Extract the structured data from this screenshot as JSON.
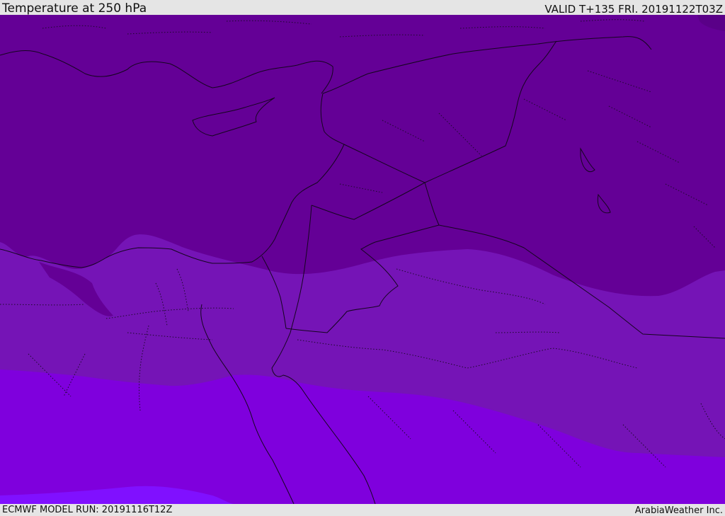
{
  "header": {
    "title": "Temperature at 250 hPa",
    "valid_time": "VALID T+135 FRI. 20191122T03Z"
  },
  "footer": {
    "model_run": "ECMWF MODEL RUN: 20191116T12Z",
    "credit": "ArabiaWeather Inc."
  },
  "map": {
    "field": "temperature",
    "level": "250 hPa",
    "band_colors": [
      "#640096",
      "#7514b6",
      "#7f00dd",
      "#8010ff"
    ]
  }
}
